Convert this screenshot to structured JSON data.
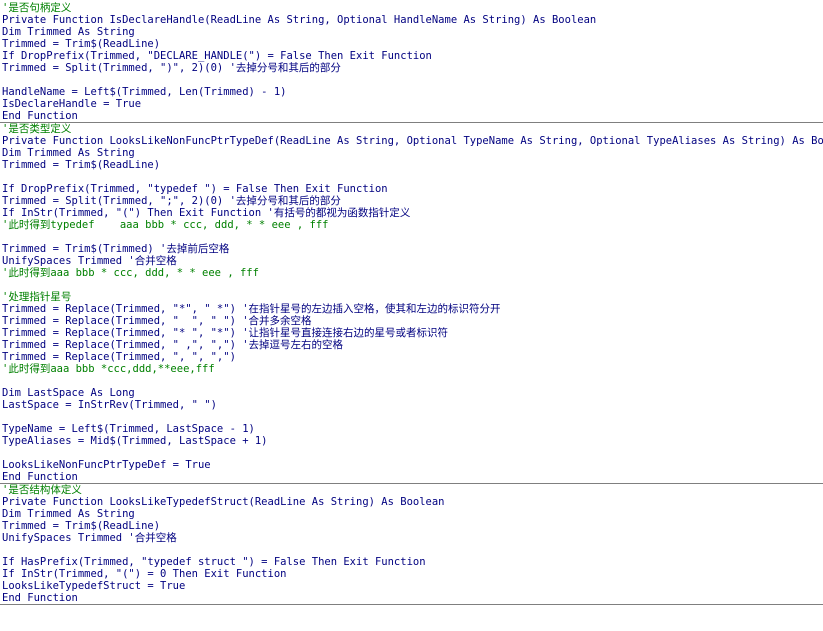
{
  "editor": {
    "colors": {
      "code": "#000080",
      "comment": "#008000",
      "separator": "#7f7f7f",
      "background": "#ffffff"
    },
    "procedures": [
      {
        "name": "IsDeclareHandle",
        "lines": [
          {
            "text": "'是否句柄定义",
            "kind": "comment"
          },
          {
            "text": "Private Function IsDeclareHandle(ReadLine As String, Optional HandleName As String) As Boolean",
            "kind": "code"
          },
          {
            "text": "Dim Trimmed As String",
            "kind": "code"
          },
          {
            "text": "Trimmed = Trim$(ReadLine)",
            "kind": "code"
          },
          {
            "text": "If DropPrefix(Trimmed, \"DECLARE_HANDLE(\") = False Then Exit Function",
            "kind": "code"
          },
          {
            "text": "Trimmed = Split(Trimmed, \")\", 2)(0) '去掉分号和其后的部分",
            "kind": "code"
          },
          {
            "text": "",
            "kind": "code"
          },
          {
            "text": "HandleName = Left$(Trimmed, Len(Trimmed) - 1)",
            "kind": "code"
          },
          {
            "text": "IsDeclareHandle = True",
            "kind": "code"
          },
          {
            "text": "End Function",
            "kind": "code"
          }
        ]
      },
      {
        "name": "LooksLikeNonFuncPtrTypeDef",
        "lines": [
          {
            "text": "'是否类型定义",
            "kind": "comment"
          },
          {
            "text": "Private Function LooksLikeNonFuncPtrTypeDef(ReadLine As String, Optional TypeName As String, Optional TypeAliases As String) As Boolean",
            "kind": "code"
          },
          {
            "text": "Dim Trimmed As String",
            "kind": "code"
          },
          {
            "text": "Trimmed = Trim$(ReadLine)",
            "kind": "code"
          },
          {
            "text": "",
            "kind": "code"
          },
          {
            "text": "If DropPrefix(Trimmed, \"typedef \") = False Then Exit Function",
            "kind": "code"
          },
          {
            "text": "Trimmed = Split(Trimmed, \";\", 2)(0) '去掉分号和其后的部分",
            "kind": "code"
          },
          {
            "text": "If InStr(Trimmed, \"(\") Then Exit Function '有括号的都视为函数指针定义",
            "kind": "code"
          },
          {
            "text": "'此时得到typedef    aaa bbb * ccc, ddd, * * eee , fff",
            "kind": "comment"
          },
          {
            "text": "",
            "kind": "code"
          },
          {
            "text": "Trimmed = Trim$(Trimmed) '去掉前后空格",
            "kind": "code"
          },
          {
            "text": "UnifySpaces Trimmed '合并空格",
            "kind": "code"
          },
          {
            "text": "'此时得到aaa bbb * ccc, ddd, * * eee , fff",
            "kind": "comment"
          },
          {
            "text": "",
            "kind": "code"
          },
          {
            "text": "'处理指针星号",
            "kind": "comment"
          },
          {
            "text": "Trimmed = Replace(Trimmed, \"*\", \" *\") '在指针星号的左边插入空格，使其和左边的标识符分开",
            "kind": "code"
          },
          {
            "text": "Trimmed = Replace(Trimmed, \"  \", \" \") '合并多余空格",
            "kind": "code"
          },
          {
            "text": "Trimmed = Replace(Trimmed, \"* \", \"*\") '让指针星号直接连接右边的星号或者标识符",
            "kind": "code"
          },
          {
            "text": "Trimmed = Replace(Trimmed, \" ,\", \",\") '去掉逗号左右的空格",
            "kind": "code"
          },
          {
            "text": "Trimmed = Replace(Trimmed, \", \", \",\")",
            "kind": "code"
          },
          {
            "text": "'此时得到aaa bbb *ccc,ddd,**eee,fff",
            "kind": "comment"
          },
          {
            "text": "",
            "kind": "code"
          },
          {
            "text": "Dim LastSpace As Long",
            "kind": "code"
          },
          {
            "text": "LastSpace = InStrRev(Trimmed, \" \")",
            "kind": "code"
          },
          {
            "text": "",
            "kind": "code"
          },
          {
            "text": "TypeName = Left$(Trimmed, LastSpace - 1)",
            "kind": "code"
          },
          {
            "text": "TypeAliases = Mid$(Trimmed, LastSpace + 1)",
            "kind": "code"
          },
          {
            "text": "",
            "kind": "code"
          },
          {
            "text": "LooksLikeNonFuncPtrTypeDef = True",
            "kind": "code"
          },
          {
            "text": "End Function",
            "kind": "code"
          }
        ]
      },
      {
        "name": "LooksLikeTypedefStruct",
        "lines": [
          {
            "text": "'是否结构体定义",
            "kind": "comment"
          },
          {
            "text": "Private Function LooksLikeTypedefStruct(ReadLine As String) As Boolean",
            "kind": "code"
          },
          {
            "text": "Dim Trimmed As String",
            "kind": "code"
          },
          {
            "text": "Trimmed = Trim$(ReadLine)",
            "kind": "code"
          },
          {
            "text": "UnifySpaces Trimmed '合并空格",
            "kind": "code"
          },
          {
            "text": "",
            "kind": "code"
          },
          {
            "text": "If HasPrefix(Trimmed, \"typedef struct \") = False Then Exit Function",
            "kind": "code"
          },
          {
            "text": "If InStr(Trimmed, \"(\") = 0 Then Exit Function",
            "kind": "code"
          },
          {
            "text": "LooksLikeTypedefStruct = True",
            "kind": "code"
          },
          {
            "text": "End Function",
            "kind": "code"
          }
        ]
      }
    ]
  }
}
